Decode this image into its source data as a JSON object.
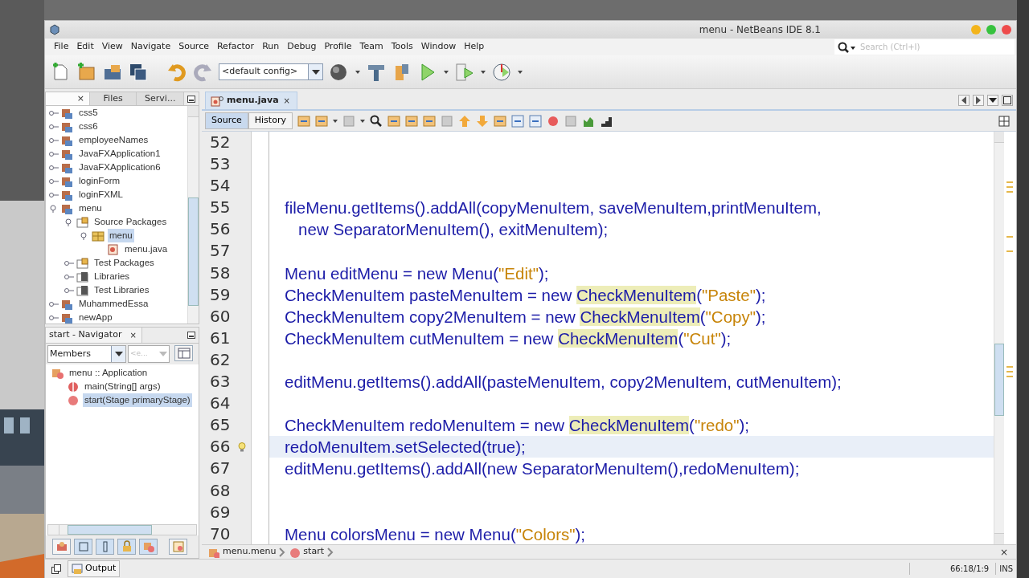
{
  "window": {
    "title": "menu - NetBeans IDE 8.1"
  },
  "menu_bar": [
    "File",
    "Edit",
    "View",
    "Navigate",
    "Source",
    "Refactor",
    "Run",
    "Debug",
    "Profile",
    "Team",
    "Tools",
    "Window",
    "Help"
  ],
  "search": {
    "placeholder": "Search (Ctrl+I)"
  },
  "toolbar": {
    "config": "<default config>"
  },
  "projects_panel": {
    "tabs": [
      {
        "label": "×",
        "selected": true
      },
      {
        "label": "Files",
        "selected": false
      },
      {
        "label": "Servi...",
        "selected": false
      }
    ],
    "tree": [
      {
        "label": "css5",
        "kind": "project",
        "expanded": false,
        "selected": false
      },
      {
        "label": "css6",
        "kind": "project",
        "expanded": false,
        "selected": false
      },
      {
        "label": "employeeNames",
        "kind": "project",
        "expanded": false,
        "selected": false
      },
      {
        "label": "JavaFXApplication1",
        "kind": "project",
        "expanded": false,
        "selected": false
      },
      {
        "label": "JavaFXApplication6",
        "kind": "project",
        "expanded": false,
        "selected": false
      },
      {
        "label": "loginForm",
        "kind": "project",
        "expanded": false,
        "selected": false
      },
      {
        "label": "loginFXML",
        "kind": "project",
        "expanded": false,
        "selected": false
      },
      {
        "label": "menu",
        "kind": "project",
        "expanded": true,
        "selected": false,
        "children": [
          {
            "label": "Source Packages",
            "kind": "folder",
            "expanded": true,
            "selected": false,
            "children": [
              {
                "label": "menu",
                "kind": "package",
                "expanded": true,
                "selected": true,
                "children": [
                  {
                    "label": "menu.java",
                    "kind": "file",
                    "selected": false
                  }
                ]
              }
            ]
          },
          {
            "label": "Test Packages",
            "kind": "folder",
            "expanded": false,
            "selected": false
          },
          {
            "label": "Libraries",
            "kind": "library",
            "expanded": false,
            "selected": false
          },
          {
            "label": "Test Libraries",
            "kind": "library",
            "expanded": false,
            "selected": false
          }
        ]
      },
      {
        "label": "MuhammedEssa",
        "kind": "project",
        "expanded": false,
        "selected": false
      },
      {
        "label": "newApp",
        "kind": "project",
        "expanded": false,
        "selected": false
      }
    ]
  },
  "navigator": {
    "title": "start - Navigator",
    "close": "×",
    "filter": "Members",
    "filter_2": {
      "value": "<e...",
      "disabled": true
    },
    "tree": [
      {
        "label": "menu :: Application",
        "kind": "class",
        "selected": false,
        "children": [
          {
            "label": "main(String[] args)",
            "kind": "static-method",
            "selected": false
          },
          {
            "label": "start(Stage primaryStage)",
            "kind": "method",
            "selected": true
          }
        ]
      }
    ]
  },
  "editor_tabs": [
    {
      "label": "menu.java",
      "close": "×",
      "selected": true
    }
  ],
  "view_tabs": [
    {
      "label": "Source",
      "selected": true
    },
    {
      "label": "History",
      "selected": false
    }
  ],
  "code": [
    {
      "number": "52",
      "current": false
    },
    {
      "number": "53",
      "current": false
    },
    {
      "number": "54",
      "current": false
    },
    {
      "number": "55",
      "current": false,
      "segments": [
        {
          "kind": "code",
          "text": "fileMenu.getItems().addAll(copyMenuItem, saveMenuItem,printMenuItem,"
        }
      ]
    },
    {
      "number": "56",
      "current": false,
      "segments": [
        {
          "kind": "code",
          "text": "   new SeparatorMenuItem(), exitMenuItem);"
        }
      ]
    },
    {
      "number": "57",
      "current": false
    },
    {
      "number": "58",
      "current": false,
      "segments": [
        {
          "kind": "code",
          "text": "Menu editMenu = new Menu("
        },
        {
          "kind": "string",
          "text": "\"Edit\""
        },
        {
          "kind": "code",
          "text": ");"
        }
      ]
    },
    {
      "number": "59",
      "current": false,
      "segments": [
        {
          "kind": "code",
          "text": "CheckMenuItem pasteMenuItem = new "
        },
        {
          "kind": "mark",
          "text": "CheckMenuItem"
        },
        {
          "kind": "code",
          "text": "("
        },
        {
          "kind": "string",
          "text": "\"Paste\""
        },
        {
          "kind": "code",
          "text": ");"
        }
      ]
    },
    {
      "number": "60",
      "current": false,
      "segments": [
        {
          "kind": "code",
          "text": "CheckMenuItem copy2MenuItem = new "
        },
        {
          "kind": "mark",
          "text": "CheckMenuItem"
        },
        {
          "kind": "code",
          "text": "("
        },
        {
          "kind": "string",
          "text": "\"Copy\""
        },
        {
          "kind": "code",
          "text": ");"
        }
      ]
    },
    {
      "number": "61",
      "current": false,
      "segments": [
        {
          "kind": "code",
          "text": "CheckMenuItem cutMenuItem = new "
        },
        {
          "kind": "mark",
          "text": "CheckMenuItem"
        },
        {
          "kind": "code",
          "text": "("
        },
        {
          "kind": "string",
          "text": "\"Cut\""
        },
        {
          "kind": "code",
          "text": ");"
        }
      ]
    },
    {
      "number": "62",
      "current": false
    },
    {
      "number": "63",
      "current": false,
      "segments": [
        {
          "kind": "code",
          "text": "editMenu.getItems().addAll(pasteMenuItem, copy2MenuItem, cutMenuItem);"
        }
      ]
    },
    {
      "number": "64",
      "current": false
    },
    {
      "number": "65",
      "current": false,
      "segments": [
        {
          "kind": "code",
          "text": "CheckMenuItem redoMenuItem = new "
        },
        {
          "kind": "mark",
          "text": "CheckMenuItem"
        },
        {
          "kind": "code",
          "text": "("
        },
        {
          "kind": "string",
          "text": "\"redo\""
        },
        {
          "kind": "code",
          "text": ");"
        }
      ]
    },
    {
      "number": "66",
      "current": true,
      "hint": true,
      "segments": [
        {
          "kind": "code",
          "text": "redoMenuItem.setSelected(true);"
        }
      ]
    },
    {
      "number": "67",
      "current": false,
      "segments": [
        {
          "kind": "code",
          "text": "editMenu.getItems().addAll(new SeparatorMenuItem(),redoMenuItem);"
        }
      ]
    },
    {
      "number": "68",
      "current": false
    },
    {
      "number": "69",
      "current": false
    },
    {
      "number": "70",
      "current": false,
      "segments": [
        {
          "kind": "code",
          "text": "Menu colorsMenu = new Menu("
        },
        {
          "kind": "string",
          "text": "\"Colors\""
        },
        {
          "kind": "code",
          "text": ");"
        }
      ]
    }
  ],
  "breadcrumb": [
    {
      "label": "menu.menu",
      "kind": "class"
    },
    {
      "label": "start",
      "kind": "method"
    }
  ],
  "breadcrumb_close": "×",
  "status_bar": {
    "output": "Output",
    "position": "66:18/1:9",
    "mode": "INS"
  }
}
